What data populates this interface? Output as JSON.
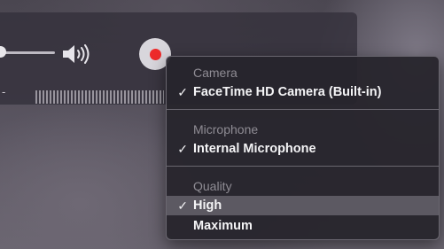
{
  "toolbar": {
    "time_display": "-",
    "volume_icon": "speaker-wave-icon",
    "record_icon": "record-dot-icon",
    "volume_level": 0.0
  },
  "menu": {
    "sections": [
      {
        "header": "Camera",
        "items": [
          {
            "label": "FaceTime HD Camera (Built-in)",
            "checked": true,
            "highlighted": false
          }
        ]
      },
      {
        "header": "Microphone",
        "items": [
          {
            "label": "Internal Microphone",
            "checked": true,
            "highlighted": false
          }
        ]
      },
      {
        "header": "Quality",
        "items": [
          {
            "label": "High",
            "checked": true,
            "highlighted": true
          },
          {
            "label": "Maximum",
            "checked": false,
            "highlighted": false
          }
        ]
      }
    ],
    "check_glyph": "✓"
  },
  "colors": {
    "record_red": "#ee2b2b",
    "menu_highlight": "#5c5962"
  }
}
